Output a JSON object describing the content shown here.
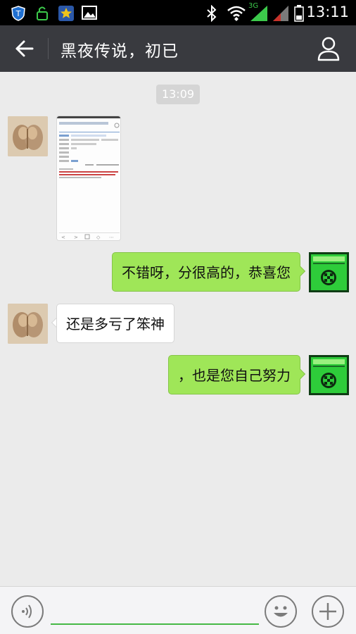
{
  "status_bar": {
    "time": "13:11",
    "network": "3G",
    "icons": [
      "shield-icon",
      "lock-icon",
      "star-app-icon",
      "image-icon",
      "bluetooth-icon",
      "wifi-icon",
      "signal-icon",
      "battery-icon"
    ]
  },
  "header": {
    "title": "黑夜传说，初已",
    "back_icon": "back-arrow-icon",
    "profile_icon": "person-icon",
    "bg_color": "#393a3f"
  },
  "chat": {
    "timestamp": "13:09",
    "messages": [
      {
        "side": "left",
        "type": "image",
        "content": "screenshot-thumbnail"
      },
      {
        "side": "right",
        "type": "text",
        "text": "不错呀，分很高的，恭喜您"
      },
      {
        "side": "left",
        "type": "text",
        "text": "还是多亏了笨神"
      },
      {
        "side": "right",
        "type": "text",
        "text": "，也是您自己努力"
      }
    ]
  },
  "input_bar": {
    "value": "",
    "voice_icon": "voice-icon",
    "emoji_icon": "emoji-icon",
    "plus_icon": "plus-icon"
  },
  "colors": {
    "outgoing_bubble": "#9fe658",
    "incoming_bubble": "#ffffff",
    "chat_background": "#ebebeb",
    "input_underline": "#46b946"
  }
}
